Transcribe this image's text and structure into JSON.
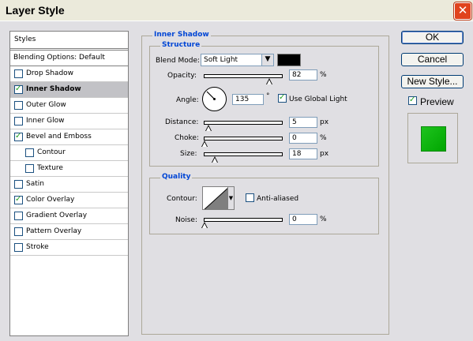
{
  "window": {
    "title": "Layer Style"
  },
  "styles_panel": {
    "header": "Styles",
    "blending_options": "Blending Options: Default",
    "items": [
      {
        "label": "Drop Shadow",
        "checked": false,
        "selected": false,
        "indent": false
      },
      {
        "label": "Inner Shadow",
        "checked": true,
        "selected": true,
        "indent": false
      },
      {
        "label": "Outer Glow",
        "checked": false,
        "selected": false,
        "indent": false
      },
      {
        "label": "Inner Glow",
        "checked": false,
        "selected": false,
        "indent": false
      },
      {
        "label": "Bevel and Emboss",
        "checked": true,
        "selected": false,
        "indent": false
      },
      {
        "label": "Contour",
        "checked": false,
        "selected": false,
        "indent": true
      },
      {
        "label": "Texture",
        "checked": false,
        "selected": false,
        "indent": true
      },
      {
        "label": "Satin",
        "checked": false,
        "selected": false,
        "indent": false
      },
      {
        "label": "Color Overlay",
        "checked": true,
        "selected": false,
        "indent": false
      },
      {
        "label": "Gradient Overlay",
        "checked": false,
        "selected": false,
        "indent": false
      },
      {
        "label": "Pattern Overlay",
        "checked": false,
        "selected": false,
        "indent": false
      },
      {
        "label": "Stroke",
        "checked": false,
        "selected": false,
        "indent": false
      }
    ]
  },
  "inner_shadow": {
    "section_title": "Inner Shadow",
    "structure": {
      "title": "Structure",
      "blend_mode_label": "Blend Mode:",
      "blend_mode": "Soft Light",
      "shadow_color": "#000000",
      "opacity_label": "Opacity:",
      "opacity": "82",
      "opacity_unit": "%",
      "angle_label": "Angle:",
      "angle": "135",
      "angle_unit": "°",
      "use_global_light_label": "Use Global Light",
      "use_global_light": true,
      "distance_label": "Distance:",
      "distance": "5",
      "distance_unit": "px",
      "choke_label": "Choke:",
      "choke": "0",
      "choke_unit": "%",
      "size_label": "Size:",
      "size": "18",
      "size_unit": "px"
    },
    "quality": {
      "title": "Quality",
      "contour_label": "Contour:",
      "anti_aliased_label": "Anti-aliased",
      "anti_aliased": false,
      "noise_label": "Noise:",
      "noise": "0",
      "noise_unit": "%"
    }
  },
  "buttons": {
    "ok": "OK",
    "cancel": "Cancel",
    "new_style": "New Style..."
  },
  "preview": {
    "label": "Preview",
    "checked": true,
    "swatch_color": "#1ec31e"
  },
  "tick_glyph": "✓",
  "close_glyph": "✕",
  "dropdown_glyph": "▼",
  "icons": [
    "close-icon",
    "check-icon",
    "dropdown-arrow-icon",
    "angle-dial-icon",
    "contour-curve-icon"
  ]
}
